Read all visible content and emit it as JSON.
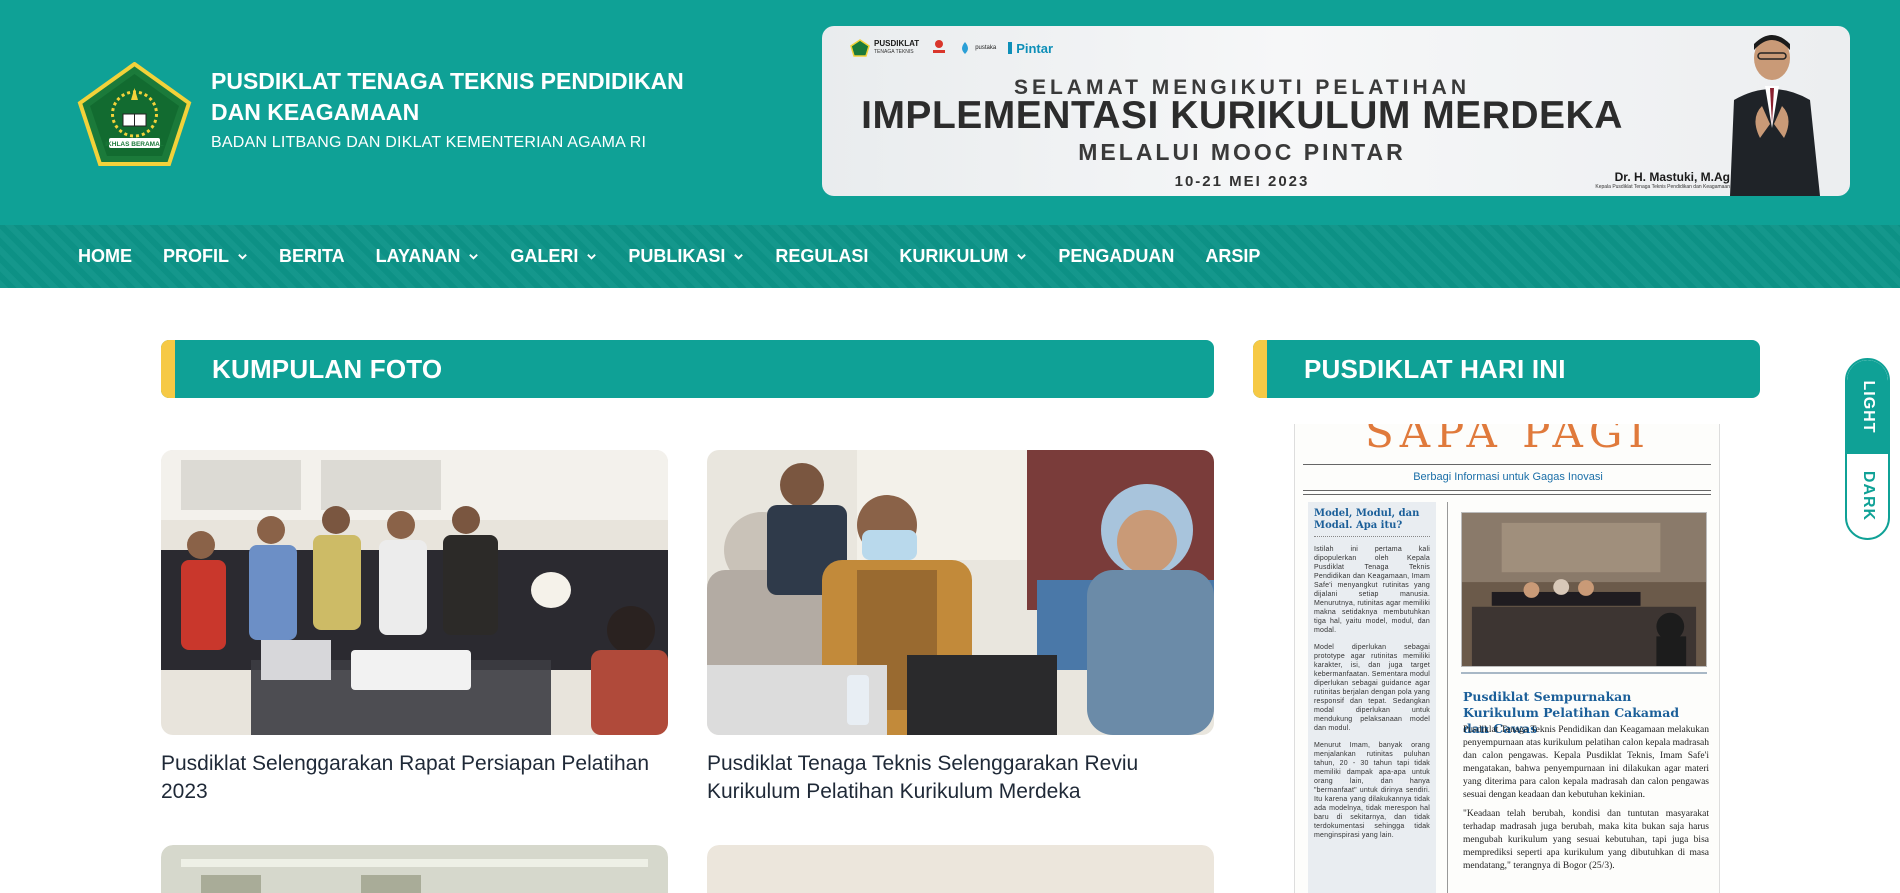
{
  "header": {
    "title": "PUSDIKLAT TENAGA TEKNIS PENDIDIKAN DAN KEAGAMAAN",
    "subtitle": "BADAN LITBANG DAN DIKLAT KEMENTERIAN AGAMA RI",
    "logo_icon": "kemenag-logo-icon",
    "logo_ribbon_text": "IKHLAS BERAMAL"
  },
  "banner": {
    "logos": {
      "pusdiklat": "PUSDIKLAT",
      "pusdiklat_sub": "TENAGA TEKNIS",
      "sipeka": "SIPEKA",
      "pustaka": "pustaka",
      "pintar": "Pintar"
    },
    "line1": "SELAMAT MENGIKUTI PELATIHAN",
    "line2": "IMPLEMENTASI KURIKULUM MERDEKA",
    "line3": "MELALUI MOOC PINTAR",
    "line4": "10-21 MEI 2023",
    "person_name": "Dr. H. Mastuki, M.Ag",
    "person_role": "Kepala Pusdiklat Tenaga Teknis Pendidikan dan Keagamaan"
  },
  "nav": {
    "items": [
      {
        "label": "HOME",
        "dropdown": false
      },
      {
        "label": "PROFIL",
        "dropdown": true
      },
      {
        "label": "BERITA",
        "dropdown": false
      },
      {
        "label": "LAYANAN",
        "dropdown": true
      },
      {
        "label": "GALERI",
        "dropdown": true
      },
      {
        "label": "PUBLIKASI",
        "dropdown": true
      },
      {
        "label": "REGULASI",
        "dropdown": false
      },
      {
        "label": "KURIKULUM",
        "dropdown": true
      },
      {
        "label": "PENGADUAN",
        "dropdown": false
      },
      {
        "label": "ARSIP",
        "dropdown": false
      }
    ]
  },
  "main": {
    "section_title": "KUMPULAN FOTO",
    "cards": [
      {
        "caption": "Pusdiklat Selenggarakan Rapat Persiapan Pelatihan 2023"
      },
      {
        "caption": "Pusdiklat Tenaga Teknis Selenggarakan Reviu Kurikulum Pelatihan Kurikulum Merdeka"
      },
      {
        "caption": ""
      },
      {
        "caption": ""
      }
    ]
  },
  "sidebar": {
    "section_title": "PUSDIKLAT HARI INI",
    "paper": {
      "masthead": "SAPA PAGI",
      "tagline": "Berbagi Informasi untuk Gagas Inovasi",
      "col_heading": "Model, Modul, dan Modal. Apa itu?",
      "col_p1": "Istilah ini pertama kali dipopulerkan oleh Kepala Pusdiklat Tenaga Teknis Pendidikan dan Keagamaan, Imam Safe'i menyangkut rutinitas yang dijalani setiap manusia. Menurutnya, rutinitas agar memiliki makna setidaknya membutuhkan tiga hal, yaitu model, modul, dan modal.",
      "col_p2": "Model diperlukan sebagai prototype agar rutinitas memiliki karakter, isi, dan juga target kebermanfaatan. Sementara modul diperlukan sebagai guidance agar rutinitas berjalan dengan pola yang responsif dan tepat. Sedangkan modal diperlukan untuk mendukung pelaksanaan model dan modul.",
      "col_p3": "Menurut Imam, banyak orang menjalankan rutinitas puluhan tahun, 20 - 30 tahun tapi tidak memiliki dampak apa-apa untuk orang lain, dan hanya \"bermanfaat\" untuk dirinya sendiri. Itu karena yang dilakukannya tidak ada modelnya, tidak merespon hal baru di sekitarnya, dan tidak terdokumentasi sehingga tidak menginspirasi yang lain.",
      "headline": "Pusdiklat Sempurnakan Kurikulum Pelatihan Cakamad dan Cawas",
      "body_p1": "Pusdiklat Tenaga Teknis Pendidikan dan Keagamaan melakukan penyempurnaan atas kurikulum pelatihan calon kepala madrasah dan calon pengawas. Kepala Pusdiklat Teknis, Imam Safe'i mengatakan, bahwa penyempurnaan ini dilakukan agar materi yang diterima para calon kepala madrasah dan calon pengawas sesuai dengan keadaan dan kebutuhan kekinian.",
      "body_p2": "\"Keadaan telah berubah, kondisi dan tuntutan masyarakat terhadap madrasah juga berubah, maka kita bukan saja harus mengubah kurikulum yang sesuai kebutuhan, tapi juga bisa memprediksi seperti apa kurikulum yang dibutuhkan di masa mendatang,\" terangnya di Bogor (25/3)."
    }
  },
  "theme_toggle": {
    "light": "LIGHT",
    "dark": "DARK"
  },
  "colors": {
    "primary": "#0fa196",
    "accent": "#f6c945",
    "nav": "#0d9488",
    "paper_blue": "#1b5f99",
    "paper_orange": "#e07a3c"
  }
}
